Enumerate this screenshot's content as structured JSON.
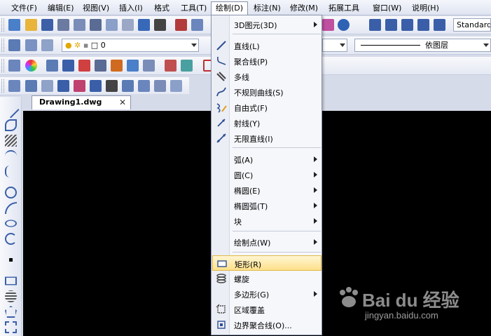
{
  "menubar": {
    "items": [
      {
        "label": "文件(F)"
      },
      {
        "label": "编辑(E)"
      },
      {
        "label": "视图(V)"
      },
      {
        "label": "插入(I)"
      },
      {
        "label": "格式"
      },
      {
        "label": "工具(T)"
      },
      {
        "label": "绘制(D)"
      },
      {
        "label": "标注(N)"
      },
      {
        "label": "修改(M)"
      },
      {
        "label": "拓展工具"
      },
      {
        "label": "窗口(W)"
      },
      {
        "label": "说明(H)"
      }
    ],
    "active_index": 6
  },
  "toolbar": {
    "text_style_value": "Standard",
    "layer_value": "0",
    "linetype_value": "依图层"
  },
  "document": {
    "tab_label": "Drawing1.dwg",
    "close_glyph": "✕"
  },
  "draw_menu": {
    "items": [
      {
        "label": "3D图元(3D)",
        "submenu": true
      },
      {
        "label": "直线(L)"
      },
      {
        "label": "聚合线(P)"
      },
      {
        "label": "多线"
      },
      {
        "label": "不规则曲线(S)"
      },
      {
        "label": "自由式(F)"
      },
      {
        "label": "射线(Y)"
      },
      {
        "label": "无限直线(I)"
      },
      {
        "label": "弧(A)",
        "submenu": true
      },
      {
        "label": "圆(C)",
        "submenu": true
      },
      {
        "label": "椭圆(E)",
        "submenu": true
      },
      {
        "label": "椭圆弧(T)",
        "submenu": true
      },
      {
        "label": "块",
        "submenu": true
      },
      {
        "label": "绘制点(W)",
        "submenu": true
      },
      {
        "label": "矩形(R)",
        "highlighted": true
      },
      {
        "label": "螺旋"
      },
      {
        "label": "多边形(G)",
        "submenu": true
      },
      {
        "label": "区域覆盖"
      },
      {
        "label": "边界聚合线(O)..."
      }
    ]
  },
  "watermark": {
    "brand": "Bai du 经验",
    "url": "jingyan.baidu.com"
  },
  "colors": {
    "canvas": "#000000",
    "highlight": "#fde08a",
    "menu_bg": "#f6f7fb"
  }
}
